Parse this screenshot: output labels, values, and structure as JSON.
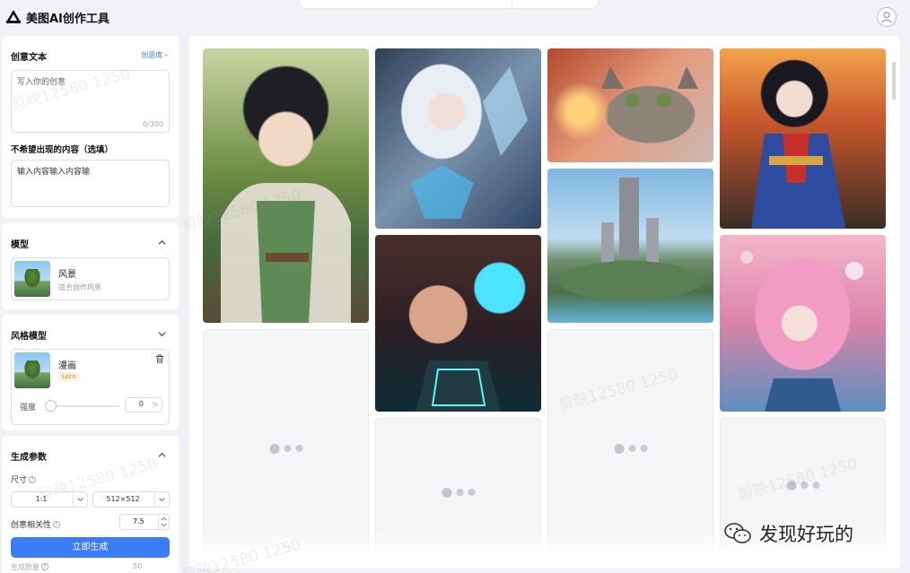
{
  "app": {
    "title": "美图AI创作工具"
  },
  "prompt": {
    "title": "创意文本",
    "library_link": "创意库",
    "placeholder": "写入你的创意",
    "counter": "0/300"
  },
  "negative": {
    "title": "不希望出现的内容（选填）",
    "value": "输入内容输入内容输"
  },
  "model": {
    "title": "模型",
    "name": "风景",
    "desc": "适合创作风景"
  },
  "style_model": {
    "title": "风格模型",
    "name": "漫画",
    "tag": "Lora",
    "strength_label": "强度",
    "strength_value": "0",
    "strength_unit": "%"
  },
  "params": {
    "title": "生成参数",
    "size_label": "尺寸",
    "ratio": "1:1",
    "resolution": "512×512",
    "relevance_label": "创意相关性",
    "relevance_value": "7.5",
    "generate_button": "立即生成",
    "count_label": "生成数量",
    "count_value": "50"
  },
  "gallery": {
    "images": [
      "fantasy-girl-fur-cloak",
      "silver-haired-ice-queen",
      "cat-with-sparklers",
      "anime-girl-red-blue-armor",
      "fantasy-island-city",
      "cyber-woman-neon",
      "pink-haired-anime-girl"
    ]
  },
  "overlay": {
    "watermark_text": "剪映12580 1250",
    "badge_text": "发现好玩的"
  }
}
